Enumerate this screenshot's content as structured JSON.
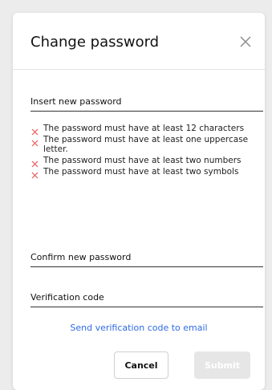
{
  "dialog": {
    "title": "Change password",
    "close_icon": "close-icon"
  },
  "fields": {
    "new_password": {
      "label": "Insert new password",
      "value": ""
    },
    "confirm_password": {
      "label": "Confirm new password",
      "value": ""
    },
    "verification_code": {
      "label": "Verification code",
      "value": ""
    }
  },
  "rules": [
    {
      "text": "The password must have at least 12 characters",
      "icon": "x-icon",
      "status": "unmet"
    },
    {
      "text": "The password must have at least one uppercase letter.",
      "icon": "x-icon",
      "status": "unmet"
    },
    {
      "text": "The password must have at least two numbers",
      "icon": "x-icon",
      "status": "unmet"
    },
    {
      "text": "The password must have at least two symbols",
      "icon": "x-icon",
      "status": "unmet"
    }
  ],
  "actions": {
    "send_code_link": "Send verification code to email",
    "cancel_label": "Cancel",
    "submit_label": "Submit"
  },
  "colors": {
    "error_icon": "#e85a5a",
    "link": "#2d6be4",
    "submit_disabled_bg": "#e6e6e6"
  }
}
